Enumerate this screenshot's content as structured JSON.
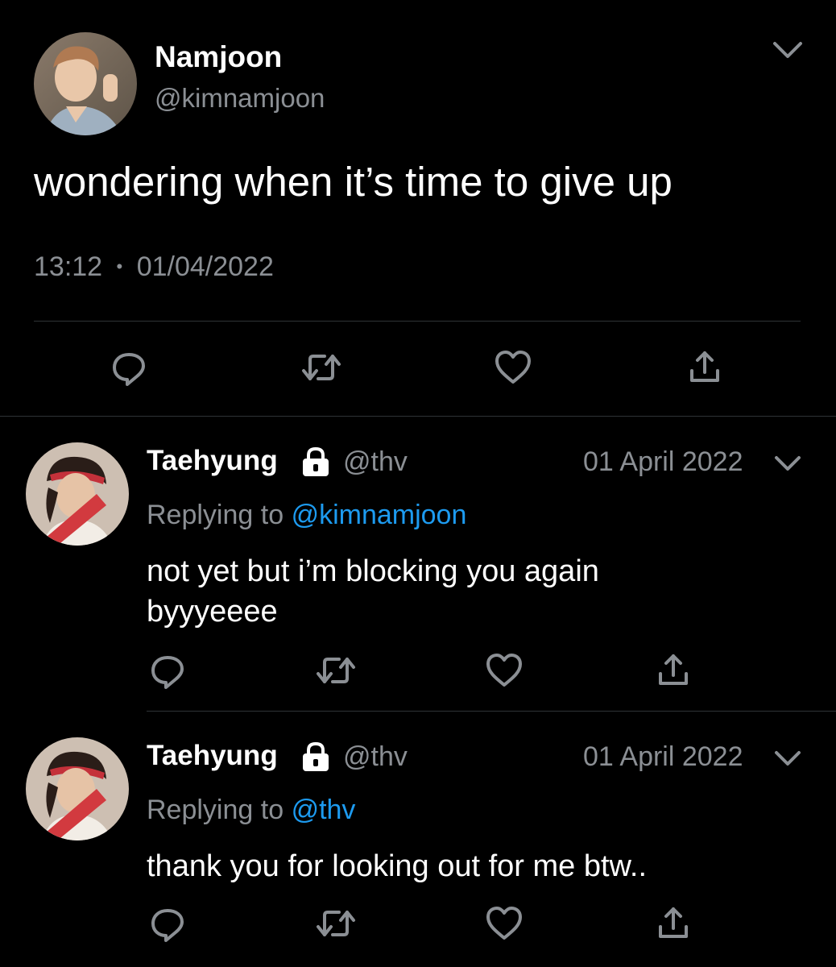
{
  "main_tweet": {
    "display_name": "Namjoon",
    "handle": "@kimnamjoon",
    "text": "wondering when it’s time to give up",
    "time": "13:12",
    "separator": "•",
    "date": "01/04/2022"
  },
  "replies": [
    {
      "display_name": "Taehyung",
      "handle": "@thv",
      "date": "01 April 2022",
      "replying_prefix": "Replying to",
      "replying_to": "@kimnamjoon",
      "text_line1": "not yet but i’m blocking you again",
      "text_line2": "byyyeeee"
    },
    {
      "display_name": "Taehyung",
      "handle": "@thv",
      "date": "01 April 2022",
      "replying_prefix": "Replying to",
      "replying_to": "@thv",
      "text_line1": "thank you for looking out for me btw.."
    }
  ],
  "icons": {
    "reply": "reply-icon",
    "retweet": "retweet-icon",
    "like": "heart-icon",
    "share": "share-icon",
    "more": "chevron-down-icon",
    "protected": "lock-icon"
  },
  "colors": {
    "background": "#000000",
    "text": "#ffffff",
    "muted": "#8b8f94",
    "link": "#1d9bf0",
    "divider": "#2f3336"
  }
}
